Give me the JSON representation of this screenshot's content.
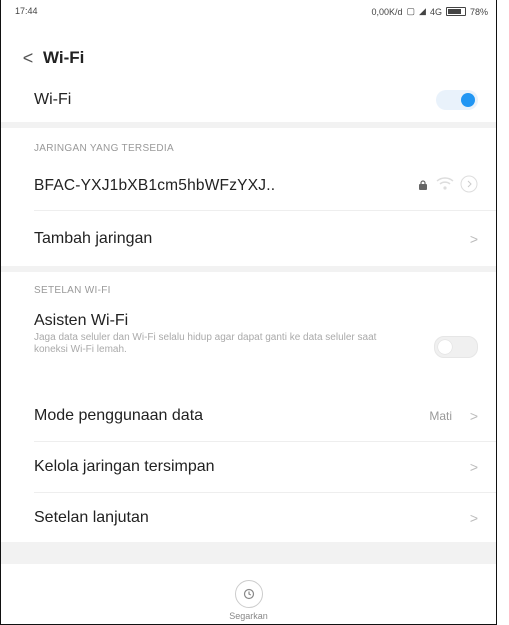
{
  "status_bar": {
    "time": "17:44",
    "speed": "0,00K/d",
    "network": "4G",
    "battery": "78%"
  },
  "header": {
    "back_glyph": "<",
    "title": "Wi-Fi"
  },
  "wifi_toggle": {
    "label": "Wi-Fi",
    "state": "on"
  },
  "available": {
    "section_title": "JARINGAN YANG TERSEDIA",
    "network_name": "BFAC-YXJ1bXB1cm5hbWFzYXJ..",
    "add_network_label": "Tambah jaringan"
  },
  "settings": {
    "section_title": "SETELAN WI-FI",
    "assistant": {
      "label": "Asisten Wi-Fi",
      "description": "Jaga data seluler dan Wi-Fi selalu hidup agar dapat ganti ke data seluler saat koneksi Wi-Fi lemah.",
      "state": "off"
    },
    "data_mode": {
      "label": "Mode penggunaan data",
      "value": "Mati"
    },
    "saved_networks_label": "Kelola jaringan tersimpan",
    "advanced_label": "Setelan lanjutan"
  },
  "refresh_label": "Segarkan",
  "colors": {
    "accent": "#2196f3"
  }
}
